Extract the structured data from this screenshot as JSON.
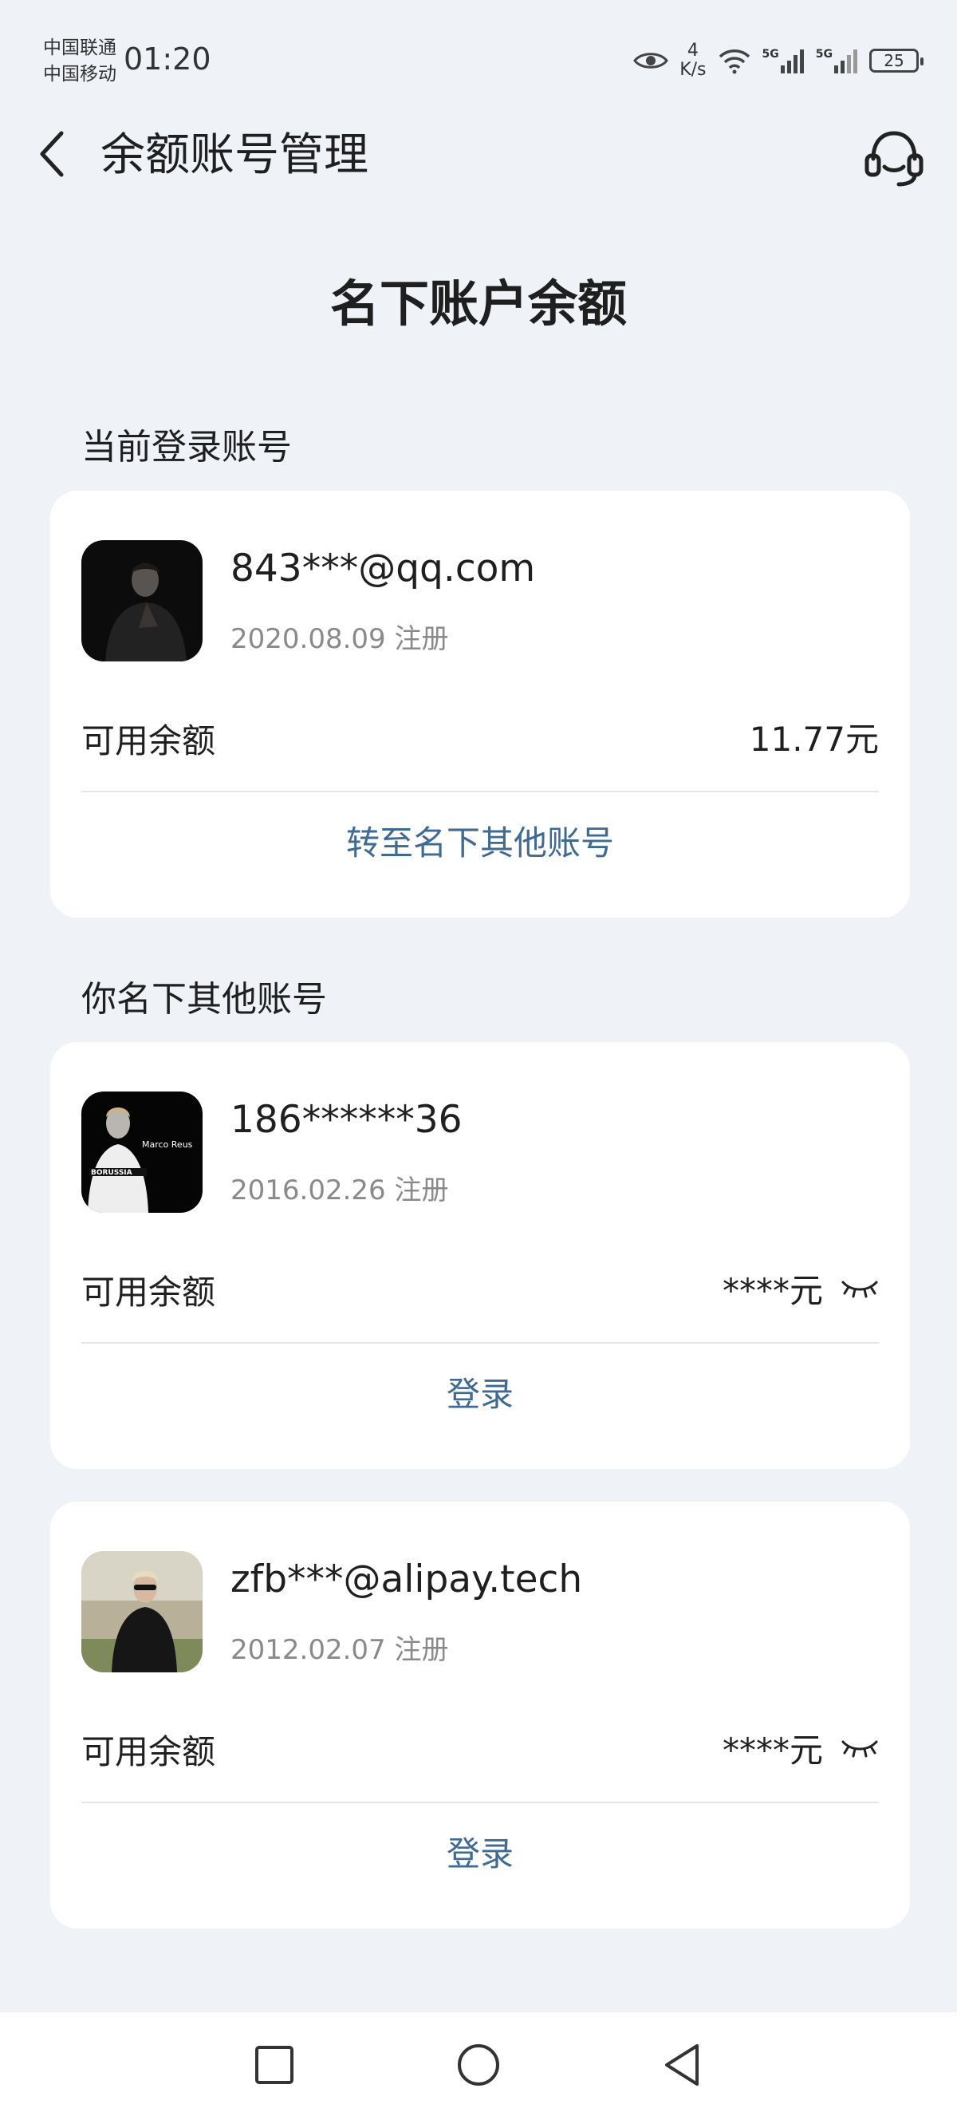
{
  "status_bar": {
    "carrier_1": "中国联通",
    "carrier_2": "中国移动",
    "time": "01:20",
    "net_speed_value": "4",
    "net_speed_unit": "K/s",
    "signal_1_label": "5G",
    "signal_2_label": "5G",
    "battery": "25"
  },
  "nav": {
    "title": "余额账号管理",
    "back_icon": "chevron-left-icon",
    "service_icon": "headset-icon"
  },
  "page": {
    "heading": "名下账户余额",
    "current_section_label": "当前登录账号",
    "other_section_label": "你名下其他账号"
  },
  "current_account": {
    "name": "843***@qq.com",
    "date": "2020.08.09 注册",
    "balance_label": "可用余额",
    "balance": "11.77元",
    "action": "转至名下其他账号"
  },
  "other_accounts": [
    {
      "name": "186******36",
      "date": "2016.02.26 注册",
      "balance_label": "可用余额",
      "balance": "****元",
      "action": "登录",
      "avatar_text": "Marco Reus",
      "avatar_text_2": "BORUSSIA"
    },
    {
      "name": "zfb***@alipay.tech",
      "date": "2012.02.07 注册",
      "balance_label": "可用余额",
      "balance": "****元",
      "action": "登录"
    }
  ],
  "colors": {
    "background": "#eff2f7",
    "card": "#ffffff",
    "link": "#3f6a94",
    "secondary_text": "#8a8a8a"
  }
}
